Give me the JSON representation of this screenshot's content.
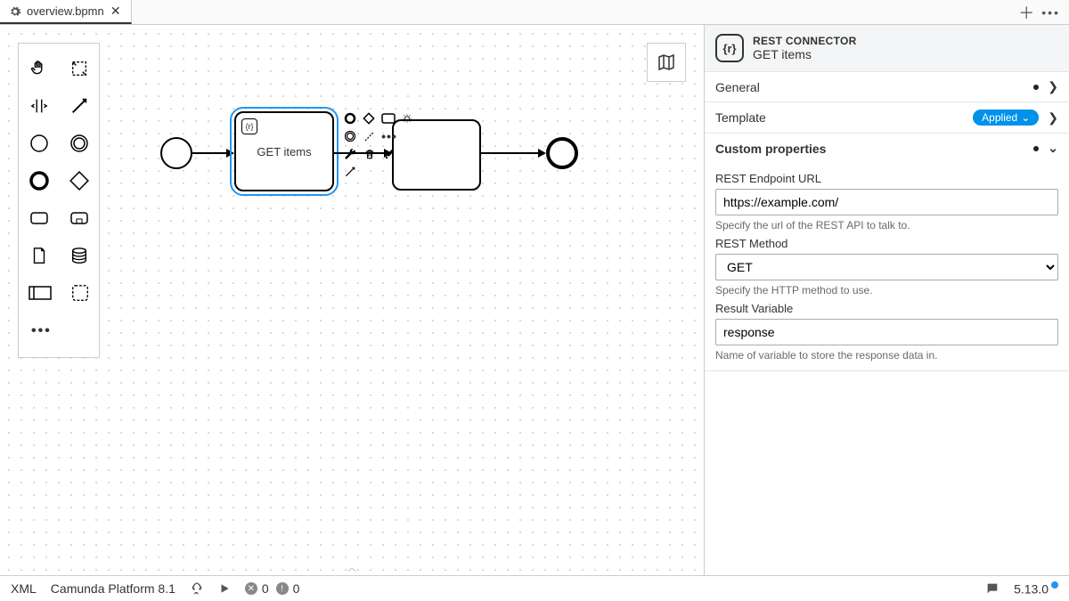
{
  "tab": {
    "filename": "overview.bpmn"
  },
  "canvas": {
    "selectedTask": {
      "label": "GET items"
    }
  },
  "panel": {
    "header": {
      "type": "REST CONNECTOR",
      "name": "GET items",
      "iconText": "{r}"
    },
    "sections": {
      "general": {
        "title": "General"
      },
      "template": {
        "title": "Template",
        "badge": "Applied"
      },
      "custom": {
        "title": "Custom properties",
        "fields": {
          "url": {
            "label": "REST Endpoint URL",
            "value": "https://example.com/",
            "help": "Specify the url of the REST API to talk to."
          },
          "method": {
            "label": "REST Method",
            "value": "GET",
            "help": "Specify the HTTP method to use."
          },
          "result": {
            "label": "Result Variable",
            "value": "response",
            "help": "Name of variable to store the response data in."
          }
        }
      }
    }
  },
  "statusbar": {
    "xml": "XML",
    "platform": "Camunda Platform 8.1",
    "errors": "0",
    "warnings": "0",
    "version": "5.13.0"
  }
}
